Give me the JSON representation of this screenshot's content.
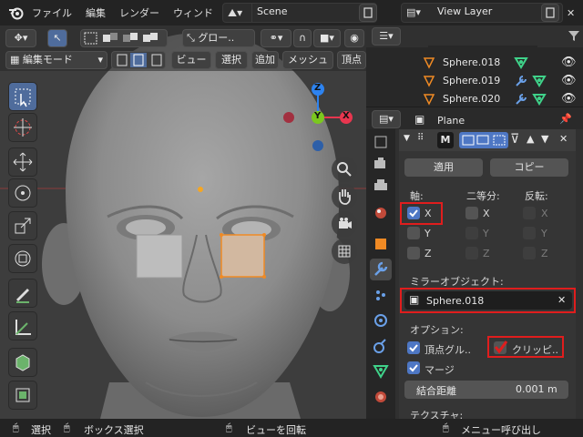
{
  "menu": [
    "ファイル",
    "編集",
    "レンダー",
    "ウィンド"
  ],
  "scene": "Scene",
  "view_layer": "View Layer",
  "viewport": {
    "orientation": "グロー..",
    "mode": "編集モード",
    "menu": [
      "ビュー",
      "選択",
      "追加",
      "メッシュ",
      "頂点"
    ]
  },
  "gizmo": {
    "z": "Z",
    "y": "Y",
    "x": "X"
  },
  "outliner": [
    "Sphere.018",
    "Sphere.019",
    "Sphere.020"
  ],
  "properties": {
    "object": "Plane",
    "modifier_initial": "M",
    "apply": "適用",
    "copy": "コピー",
    "axis_label": "軸:",
    "bisect_label": "二等分:",
    "flip_label": "反転:",
    "axes": [
      "X",
      "Y",
      "Z"
    ],
    "mirror_object_label": "ミラーオブジェクト:",
    "mirror_object": "Sphere.018",
    "options_label": "オプション:",
    "vertex_group": "頂点グル..",
    "clipping": "クリッピ..",
    "merge": "マージ",
    "merge_distance_label": "結合距離",
    "merge_distance": "0.001 m",
    "texture_label": "テクスチャ:"
  },
  "status": {
    "select": "選択",
    "box_select": "ボックス選択",
    "rotate_view": "ビューを回転",
    "call_menu": "メニュー呼び出し"
  },
  "colors": {
    "accent_blue": "#4e77c4",
    "highlight_red": "#e01d1d",
    "outliner_mod_green": "#3fd38a",
    "axis_x": "#e8364f",
    "axis_y": "#7bc81f",
    "axis_z": "#2d83f0"
  }
}
